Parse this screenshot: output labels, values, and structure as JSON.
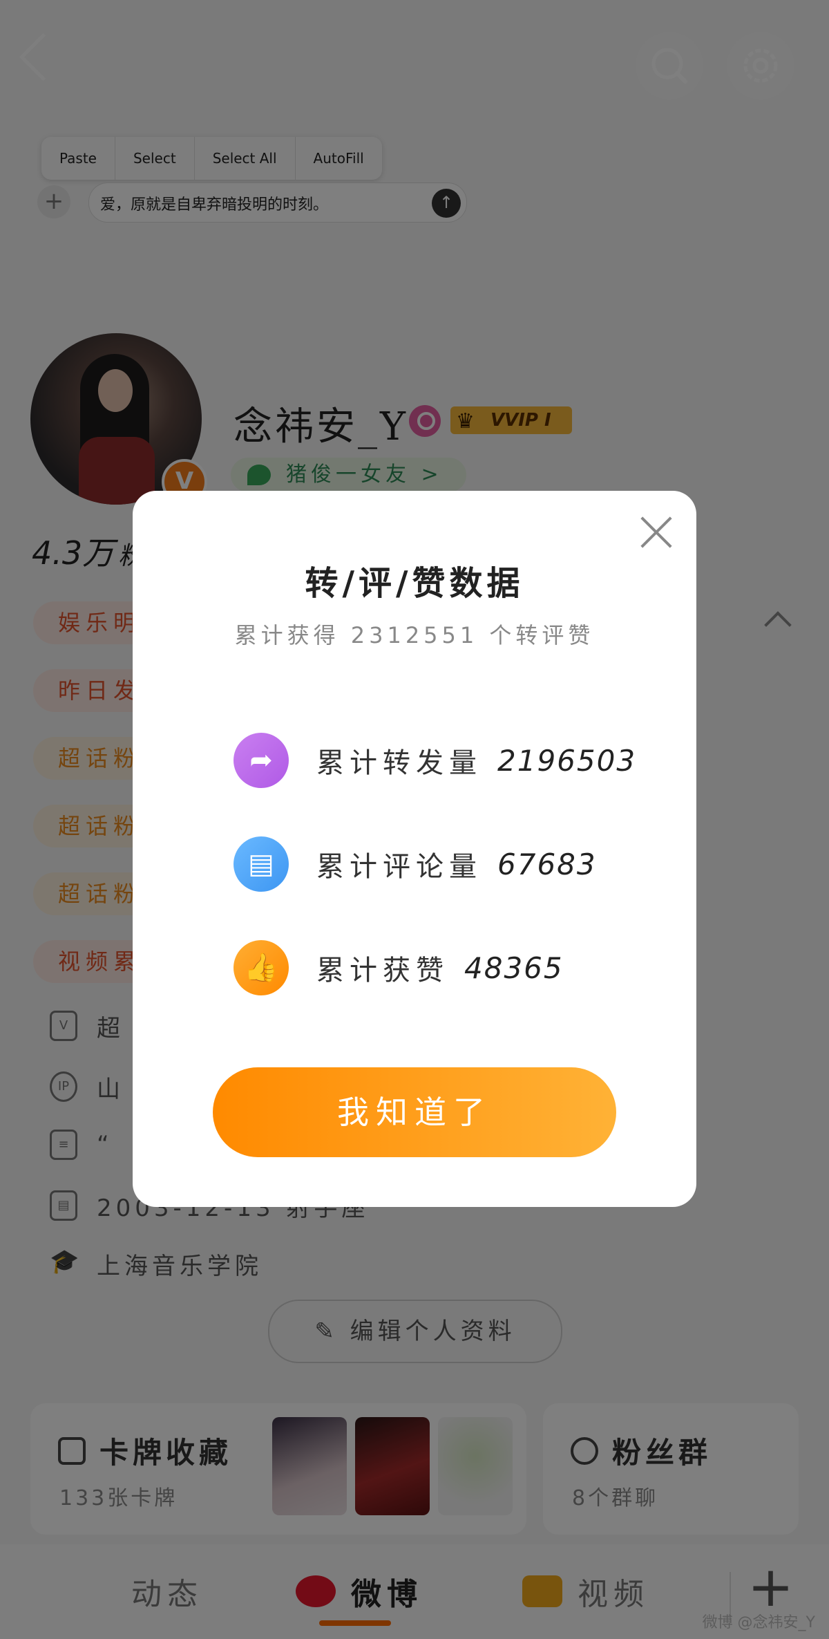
{
  "edit_menu": {
    "items": [
      "Paste",
      "Select",
      "Select All",
      "AutoFill"
    ]
  },
  "compose": {
    "text": "爱，原就是自卑弃暗投明的时刻。"
  },
  "profile": {
    "name": "念祎安_Y",
    "vip_badge": "VVIP I",
    "group_tag": "猪俊一女友 >",
    "followers_count": "4.3万",
    "followers_unit_partial": "粉"
  },
  "tags": [
    "娱乐明",
    "昨日发",
    "超话粉",
    "超话粉",
    "超话粉",
    "视频累"
  ],
  "info": {
    "super": "超",
    "ip": "山",
    "bio": "“",
    "birthday": "2003-12-13 射手座",
    "school": "上海音乐学院"
  },
  "edit_profile_label": "编辑个人资料",
  "cards": {
    "collection_title": "卡牌收藏",
    "collection_sub": "133张卡牌",
    "fans_title": "粉丝群",
    "fans_sub": "8个群聊"
  },
  "bottom_tabs": {
    "dynamic": "动态",
    "weibo": "微博",
    "video": "视频"
  },
  "watermark": "微博 @念祎安_Y",
  "modal": {
    "title": "转/评/赞数据",
    "subtitle": "累计获得 2312551 个转评赞",
    "rows": [
      {
        "label": "累计转发量",
        "value": "2196503",
        "icon": "forward-icon",
        "color": "#b05ae6"
      },
      {
        "label": "累计评论量",
        "value": "67683",
        "icon": "comment-icon",
        "color": "#3d96f2"
      },
      {
        "label": "累计获赞",
        "value": "48365",
        "icon": "thumbs-up-icon",
        "color": "#ff8a00"
      }
    ],
    "ok_button": "我知道了"
  },
  "colors": {
    "accent": "#ff8a00",
    "weibo_red": "#e6162d"
  }
}
